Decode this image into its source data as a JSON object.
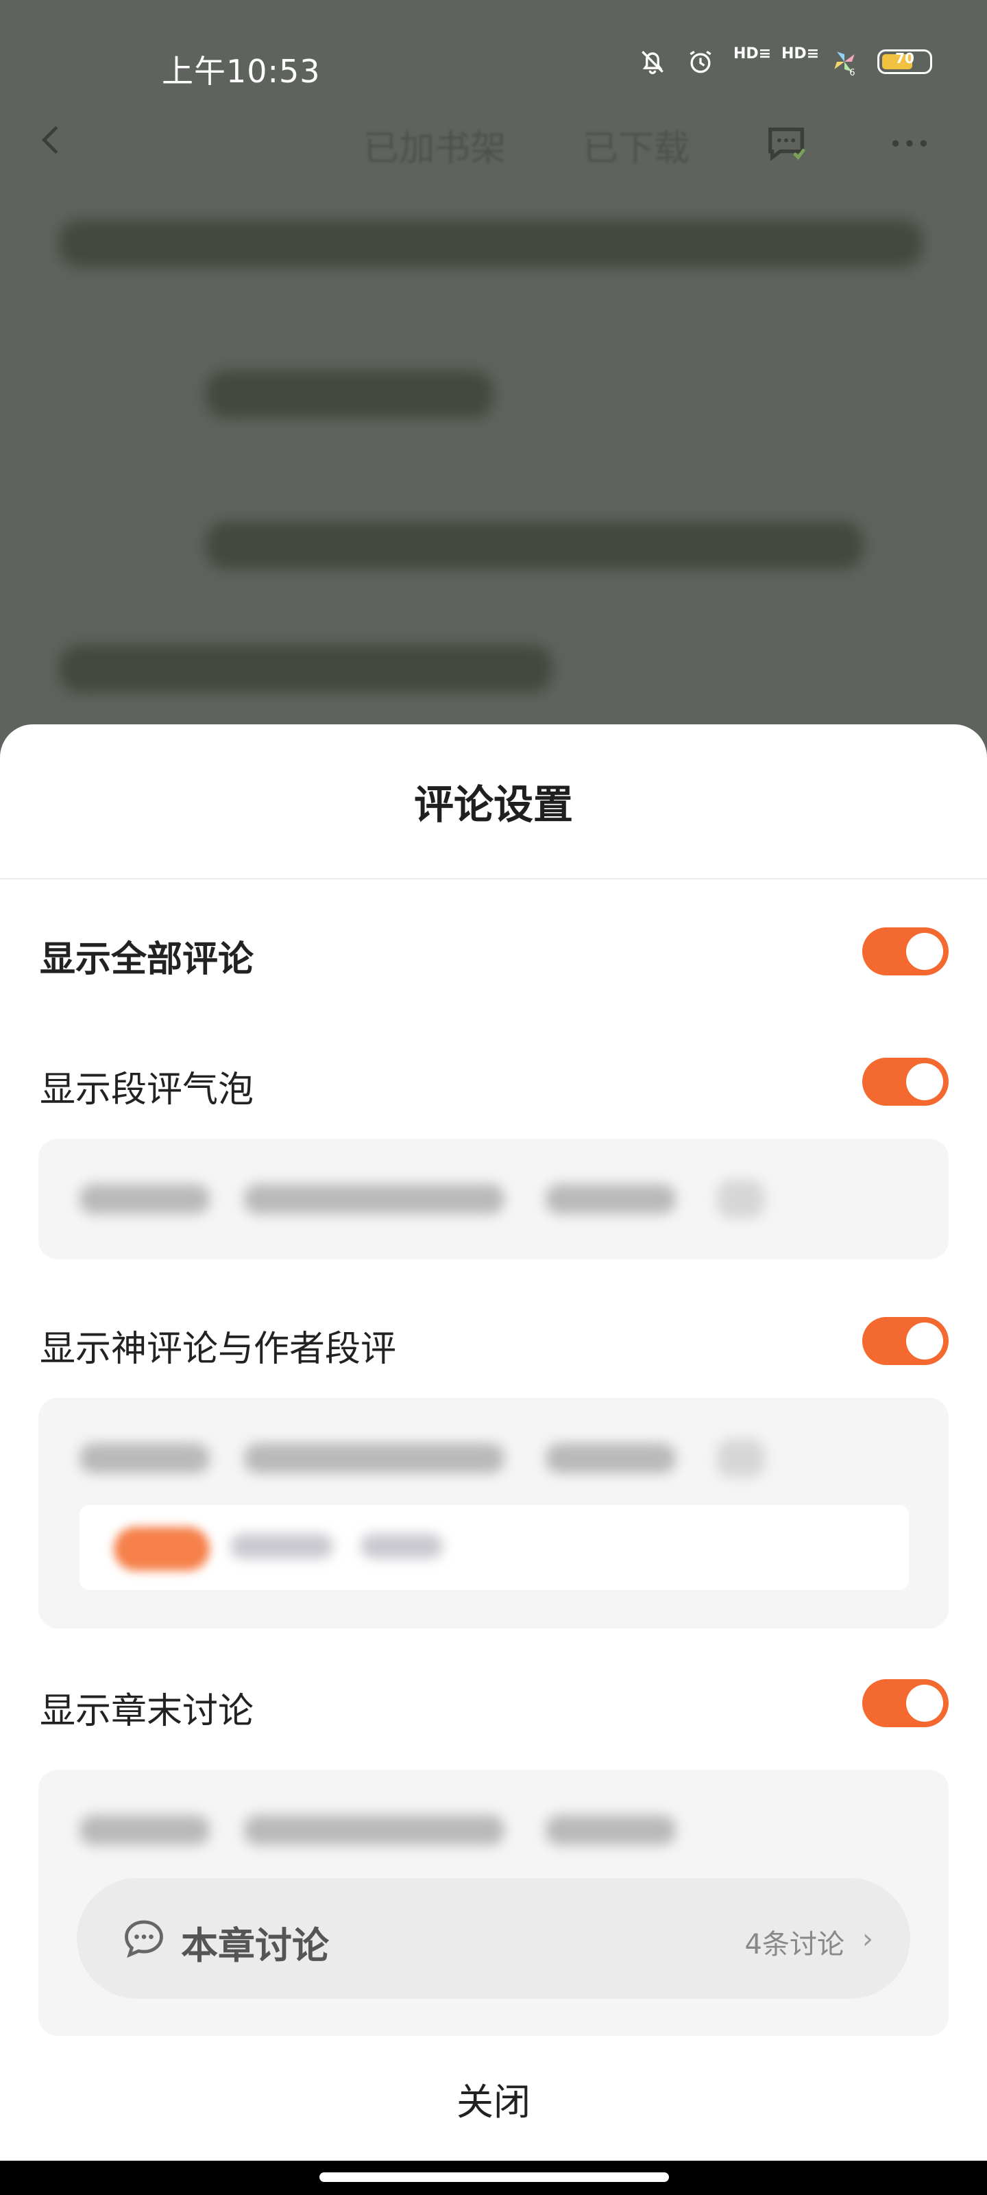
{
  "status_bar": {
    "time": "上午10:53",
    "icons": [
      "mute-bell-icon",
      "alarm-icon",
      "hd-signal-icon",
      "hd-signal-icon",
      "pinwheel-app-icon",
      "battery-icon"
    ],
    "hd_label": "HD",
    "battery_level": "70",
    "app_badge": "6"
  },
  "reader_nav": {
    "added_to_shelf": "已加书架",
    "downloaded": "已下载"
  },
  "sheet": {
    "title": "评论设置",
    "settings": [
      {
        "label": "显示全部评论",
        "on": true
      },
      {
        "label": "显示段评气泡",
        "on": true
      },
      {
        "label": "显示神评论与作者段评",
        "on": true
      },
      {
        "label": "显示章末讨论",
        "on": true
      }
    ],
    "chapter_discussion": {
      "label": "本章讨论",
      "count": "4条讨论"
    },
    "close_label": "关闭"
  },
  "colors": {
    "accent": "#f4692f",
    "overlay": "#5f635d",
    "sheet_bg": "#ffffff",
    "card_bg": "#f5f5f5"
  }
}
